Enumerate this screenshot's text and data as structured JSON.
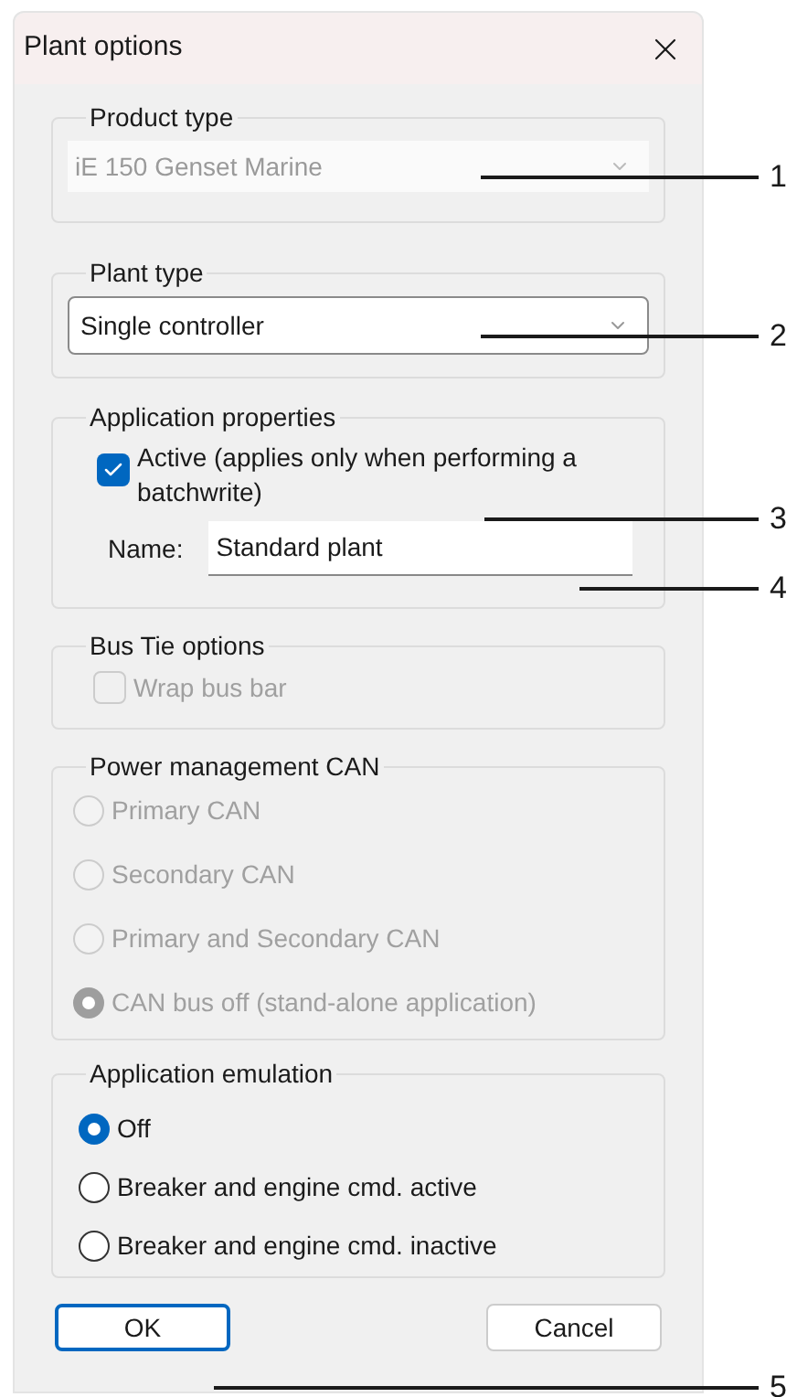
{
  "window": {
    "title": "Plant options"
  },
  "product_type": {
    "label": "Product type",
    "value": "iE 150 Genset Marine",
    "disabled": true
  },
  "plant_type": {
    "label": "Plant type",
    "value": "Single controller",
    "disabled": false
  },
  "application_properties": {
    "label": "Application properties",
    "active": {
      "label": "Active (applies only when performing a batchwrite)",
      "checked": true,
      "disabled": false
    },
    "name": {
      "label": "Name:",
      "value": "Standard plant"
    }
  },
  "bus_tie_options": {
    "label": "Bus Tie options",
    "wrap_bus_bar": {
      "label": "Wrap bus bar",
      "checked": false,
      "disabled": true
    }
  },
  "power_management_can": {
    "label": "Power management CAN",
    "options": [
      {
        "label": "Primary CAN",
        "selected": false,
        "disabled": true
      },
      {
        "label": "Secondary CAN",
        "selected": false,
        "disabled": true
      },
      {
        "label": "Primary and Secondary CAN",
        "selected": false,
        "disabled": true
      },
      {
        "label": "CAN bus off (stand-alone application)",
        "selected": true,
        "disabled": true
      }
    ]
  },
  "application_emulation": {
    "label": "Application emulation",
    "options": [
      {
        "label": "Off",
        "selected": true,
        "disabled": false
      },
      {
        "label": "Breaker and engine cmd. active",
        "selected": false,
        "disabled": false
      },
      {
        "label": "Breaker and engine cmd. inactive",
        "selected": false,
        "disabled": false
      }
    ]
  },
  "buttons": [
    {
      "label": "OK",
      "default": true
    },
    {
      "label": "Cancel",
      "default": false
    }
  ],
  "callouts": [
    "1",
    "2",
    "3",
    "4",
    "5"
  ]
}
